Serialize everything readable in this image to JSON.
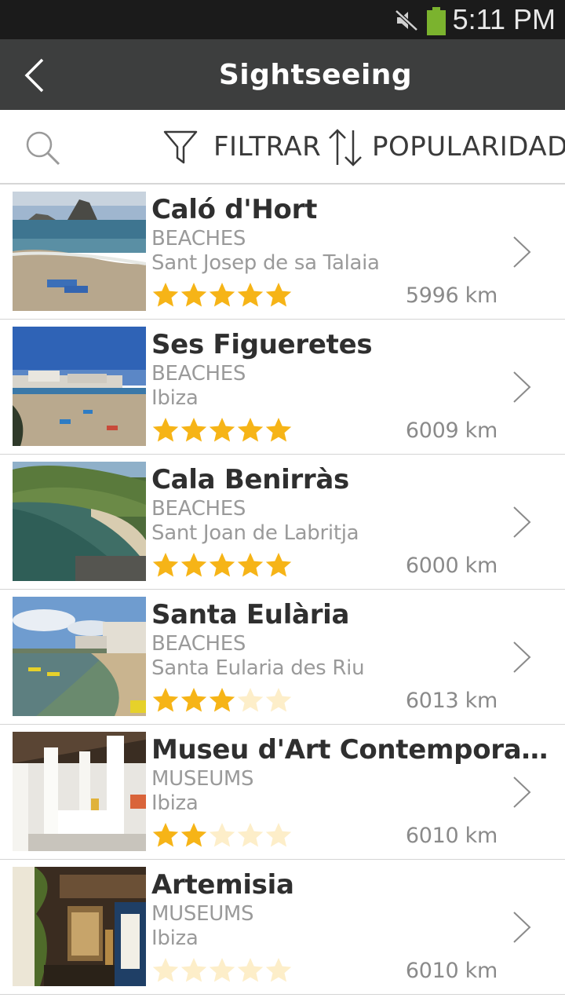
{
  "status_bar": {
    "time": "5:11 PM",
    "icons": [
      "mute-icon",
      "battery-icon"
    ],
    "battery_color": "#7bb32e"
  },
  "app_bar": {
    "title": "Sightseeing",
    "back_icon": "chevron-left-icon",
    "background": "#3d3e3e"
  },
  "toolbar": {
    "search_icon": "search-icon",
    "filter_label": "FILTRAR",
    "filter_icon": "filter-icon",
    "sort_label": "POPULARIDADE",
    "sort_icon": "sort-icon"
  },
  "star_color": "#f6b417",
  "star_empty_color": "#fdeec9",
  "items": [
    {
      "title": "Caló d'Hort",
      "category": "BEACHES",
      "location": "Sant Josep de sa Talaia",
      "rating": 5,
      "distance": "5996 km",
      "image": "beach-rock-photo"
    },
    {
      "title": "Ses Figueretes",
      "category": "BEACHES",
      "location": "Ibiza",
      "rating": 5,
      "distance": "6009 km",
      "image": "beach-town-photo"
    },
    {
      "title": "Cala Benirràs",
      "category": "BEACHES",
      "location": "Sant Joan de Labritja",
      "rating": 5,
      "distance": "6000 km",
      "image": "cove-photo"
    },
    {
      "title": "Santa Eulària",
      "category": "BEACHES",
      "location": "Santa Eularia des Riu",
      "rating": 3,
      "distance": "6013 km",
      "image": "resort-beach-photo"
    },
    {
      "title": "Museu d'Art Contemporani d'E...",
      "category": "MUSEUMS",
      "location": "Ibiza",
      "rating": 2,
      "distance": "6010 km",
      "image": "museum-interior-photo"
    },
    {
      "title": "Artemisia",
      "category": "MUSEUMS",
      "location": "Ibiza",
      "rating": 0,
      "distance": "6010 km",
      "image": "gallery-entrance-photo"
    }
  ]
}
